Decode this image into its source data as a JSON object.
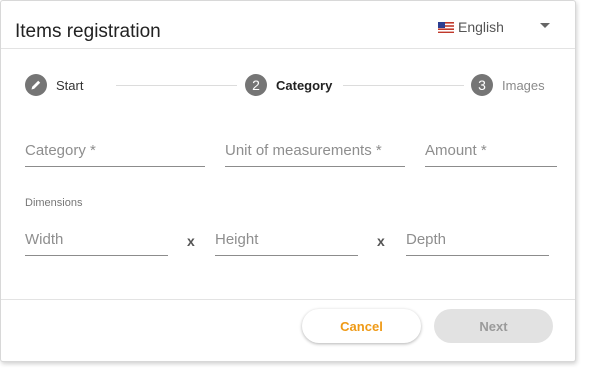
{
  "dialog": {
    "title": "Items registration",
    "language": {
      "label": "English",
      "flag_icon": "us-flag-icon"
    }
  },
  "stepper": {
    "steps": [
      {
        "label": "Start",
        "marker": "pencil-icon",
        "state": "completed"
      },
      {
        "label": "Category",
        "marker": "2",
        "state": "active"
      },
      {
        "label": "Images",
        "marker": "3",
        "state": "upcoming"
      }
    ]
  },
  "form": {
    "category": {
      "placeholder": "Category *",
      "value": ""
    },
    "unit": {
      "placeholder": "Unit of measurements *",
      "value": ""
    },
    "amount": {
      "placeholder": "Amount *",
      "value": ""
    },
    "dimensions_label": "Dimensions",
    "width": {
      "placeholder": "Width",
      "value": ""
    },
    "height": {
      "placeholder": "Height",
      "value": ""
    },
    "depth": {
      "placeholder": "Depth",
      "value": ""
    },
    "separator": "x"
  },
  "actions": {
    "cancel_label": "Cancel",
    "next_label": "Next"
  },
  "colors": {
    "accent": "#ef9a16",
    "step_circle": "#757575",
    "disabled_button": "#e2e2e2"
  }
}
